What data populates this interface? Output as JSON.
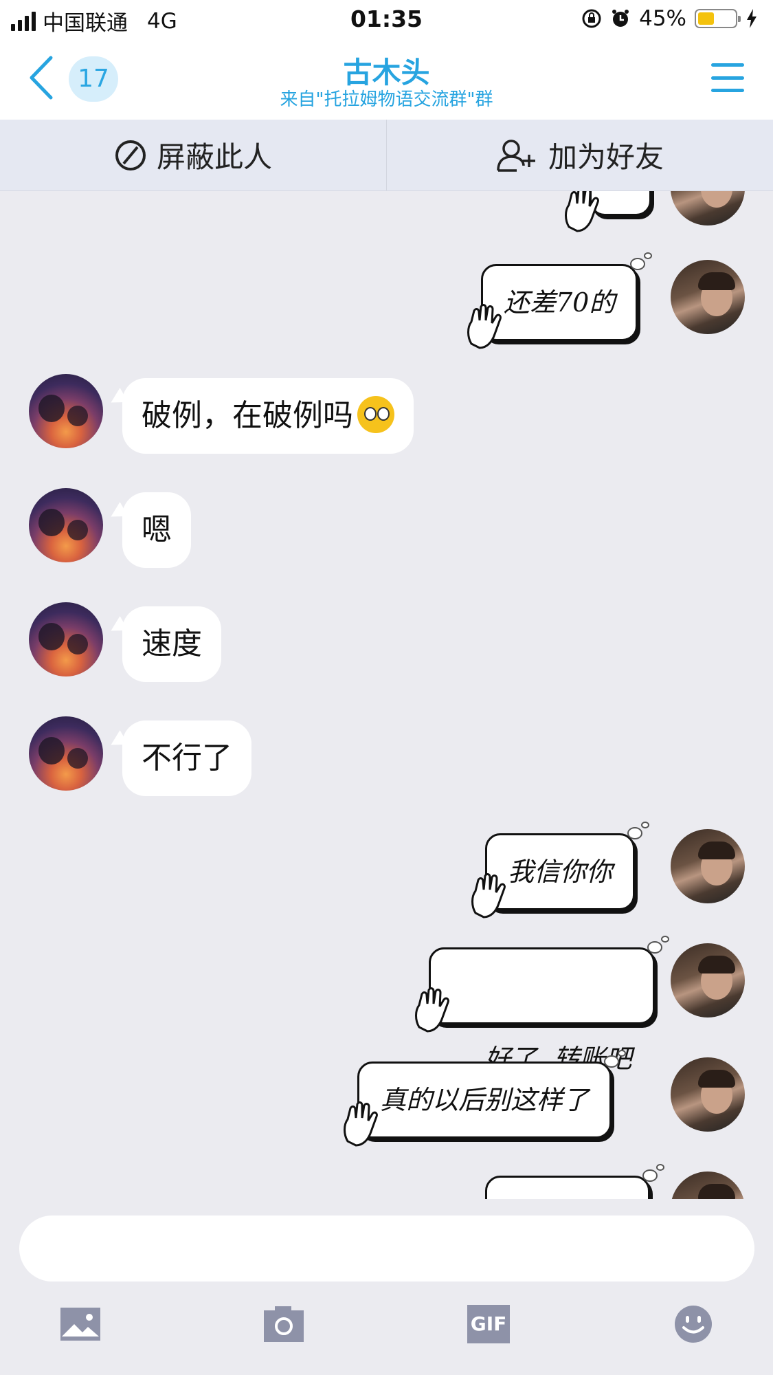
{
  "status_bar": {
    "carrier": "中国联通",
    "network": "4G",
    "time": "01:35",
    "battery_percent": "45%",
    "battery_level": 0.45,
    "battery_color": "#f4c20d"
  },
  "nav": {
    "unread_count": "17",
    "title": "古木头",
    "subtitle": "来自\"托拉姆物语交流群\"群",
    "accent_color": "#27a4e0"
  },
  "actions": {
    "block_label": "屏蔽此人",
    "add_friend_label": "加为好友"
  },
  "messages": [
    {
      "side": "right",
      "text": "还差70的"
    },
    {
      "side": "left",
      "text": "破例，在破例吗"
    },
    {
      "side": "left",
      "text": "嗯"
    },
    {
      "side": "left",
      "text": "速度"
    },
    {
      "side": "left",
      "text": "不行了"
    },
    {
      "side": "right",
      "text": "我信你你"
    },
    {
      "side": "right",
      "text": "好了  转账吧"
    },
    {
      "side": "right",
      "text": "真的以后别这样了"
    }
  ],
  "input": {
    "placeholder": ""
  },
  "toolbar": {
    "gif_label": "GIF",
    "icons": [
      "image-icon",
      "camera-icon",
      "gif-icon",
      "emoji-icon"
    ]
  }
}
